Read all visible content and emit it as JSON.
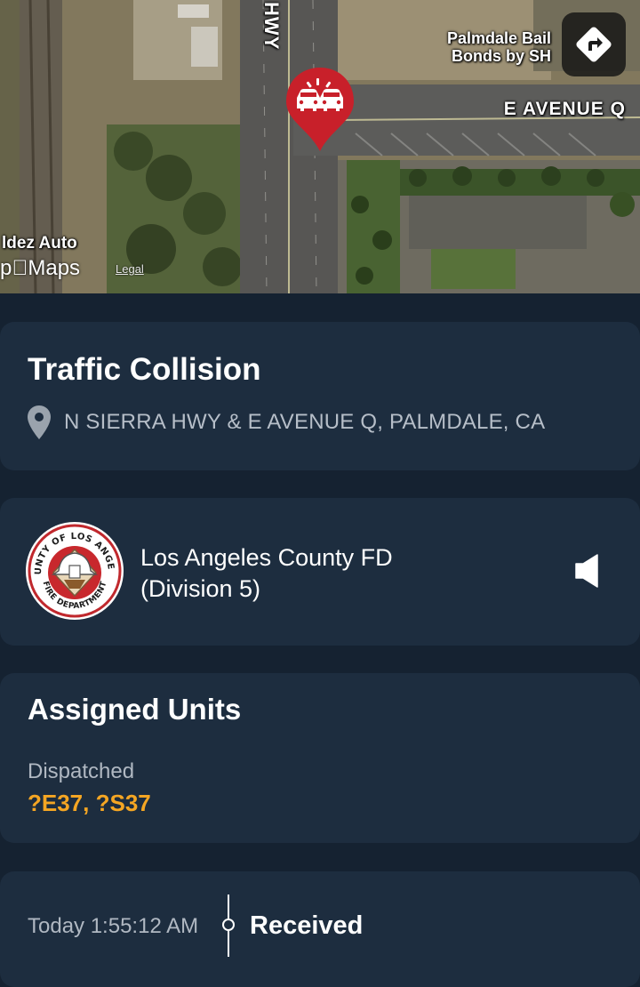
{
  "map": {
    "road_label": "HWY",
    "poi_label_line1": "Palmdale Bail",
    "poi_label_line2": "Bonds by SH",
    "street_label": "E AVENUE Q",
    "poi_label_left": "ldez Auto",
    "maps_brand": "Maps",
    "maps_brand_prefix": "p",
    "legal": "Legal",
    "pin_icon": "car-collision-icon",
    "directions_icon": "directions-icon"
  },
  "incident": {
    "title": "Traffic Collision",
    "address": "N SIERRA HWY & E AVENUE Q, PALMDALE, CA",
    "address_icon": "location-pin-icon"
  },
  "agency": {
    "name_line1": "Los Angeles County FD",
    "name_line2": "(Division 5)",
    "logo_icon": "la-county-fire-department-seal",
    "logo_text_top": "COUNTY OF LOS ANGELES",
    "logo_text_bottom": "FIRE DEPARTMENT",
    "audio_icon": "speaker-icon"
  },
  "units": {
    "title": "Assigned Units",
    "status_label": "Dispatched",
    "values": "?E37, ?S37"
  },
  "timeline": {
    "time": "Today 1:55:12 AM",
    "status": "Received"
  },
  "colors": {
    "background": "#152231",
    "card": "#1d2d3f",
    "accent_units": "#f5a623",
    "pin_red": "#c8202a"
  }
}
